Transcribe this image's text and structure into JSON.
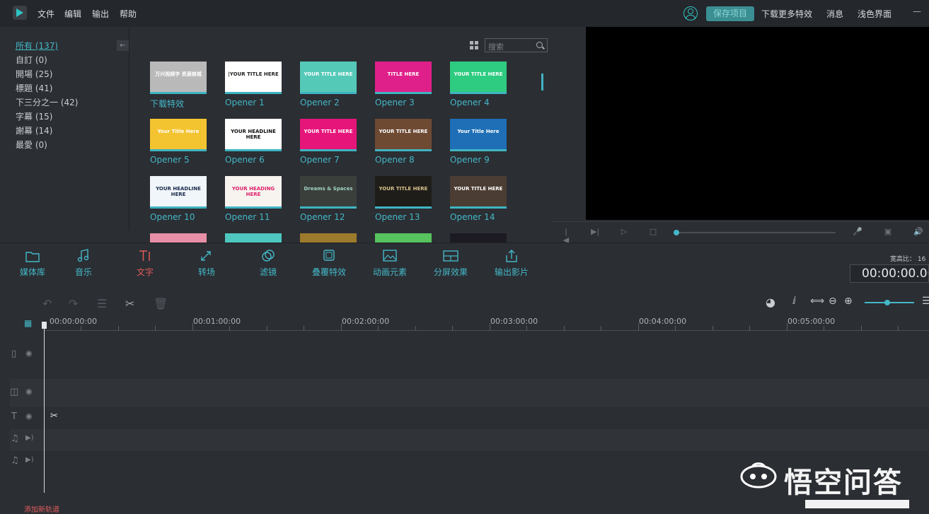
{
  "menu": {
    "file": "文件",
    "edit": "编辑",
    "export": "输出",
    "help": "帮助"
  },
  "topbar_right": {
    "save": "保存项目",
    "download": "下载更多特效",
    "messages": "消息",
    "theme": "浅色界面",
    "minimize": "—"
  },
  "categories": [
    {
      "label": "所有 (137)",
      "active": true
    },
    {
      "label": "自訂 (0)"
    },
    {
      "label": "開場 (25)"
    },
    {
      "label": "標題 (41)"
    },
    {
      "label": "下三分之一 (42)"
    },
    {
      "label": "字幕 (15)"
    },
    {
      "label": "謝幕 (14)"
    },
    {
      "label": "最愛 (0)"
    }
  ],
  "collapse_icon": "arrow-left-icon",
  "search": {
    "placeholder": "搜索"
  },
  "tiles": [
    {
      "label": "下载特效",
      "text": "万兴视频字 资源商城",
      "bg": "#b9b9b9",
      "color": "#ffffff"
    },
    {
      "label": "Opener 1",
      "text": "|YOUR TITLE HERE",
      "bg": "#ffffff",
      "color": "#222222"
    },
    {
      "label": "Opener 2",
      "text": "YOUR TITLE HERE",
      "bg": "#55c9b8",
      "color": "#ffffff"
    },
    {
      "label": "Opener 3",
      "text": "TITLE HERE",
      "bg": "#e0208a",
      "color": "#ffffff"
    },
    {
      "label": "Opener 4",
      "text": "YOUR TITLE HERE",
      "bg": "#2ecc80",
      "color": "#ffffff"
    },
    {
      "label": "Opener 5",
      "text": "Your Title Here",
      "bg": "#f4c430",
      "color": "#ffffff"
    },
    {
      "label": "Opener 6",
      "text": "YOUR HEADLINE HERE",
      "bg": "#ffffff",
      "color": "#111111"
    },
    {
      "label": "Opener 7",
      "text": "YOUR TITLE HERE",
      "bg": "#e6157a",
      "color": "#ffffff"
    },
    {
      "label": "Opener 8",
      "text": "YOUR TITLE HERE",
      "bg": "#6e4a33",
      "color": "#ffffff"
    },
    {
      "label": "Opener 9",
      "text": "Your Title Here",
      "bg": "#1e6fb5",
      "color": "#ffffff"
    },
    {
      "label": "Opener 10",
      "text": "YOUR HEADLINE HERE",
      "bg": "#f0f6fa",
      "color": "#1b2a4a"
    },
    {
      "label": "Opener 11",
      "text": "YOUR HEADING HERE",
      "bg": "#f7f4f0",
      "color": "#e0206a"
    },
    {
      "label": "Opener 12",
      "text": "Dreams & Spaces",
      "bg": "#3b3f3c",
      "color": "#9fd4c4"
    },
    {
      "label": "Opener 13",
      "text": "YOUR TITLE HERE",
      "bg": "#1f1d1a",
      "color": "#d6c28a"
    },
    {
      "label": "Opener 14",
      "text": "YOUR TITLE HERE",
      "bg": "#4b3d33",
      "color": "#ffffff"
    }
  ],
  "tools": [
    {
      "label": "媒体库",
      "icon": "folder-icon"
    },
    {
      "label": "音乐",
      "icon": "music-icon"
    },
    {
      "label": "文字",
      "icon": "text-icon",
      "active": true
    },
    {
      "label": "转场",
      "icon": "transition-icon"
    },
    {
      "label": "滤镜",
      "icon": "filter-icon"
    },
    {
      "label": "叠覆特效",
      "icon": "overlay-icon"
    },
    {
      "label": "动画元素",
      "icon": "image-icon"
    },
    {
      "label": "分屏效果",
      "icon": "split-screen-icon"
    },
    {
      "label": "输出影片",
      "icon": "export-icon"
    }
  ],
  "aspect": "宽高比： 16",
  "timecode": "00:00:00.00",
  "ruler": [
    "00:00:00:00",
    "00:01:00:00",
    "00:02:00:00",
    "00:03:00:00",
    "00:04:00:00",
    "00:05:00:00"
  ],
  "watermark": "悟空问答",
  "bottom_left_status": "添加新轨道",
  "accent_color": "#44b8c8",
  "active_tool_color": "#e35b5b"
}
